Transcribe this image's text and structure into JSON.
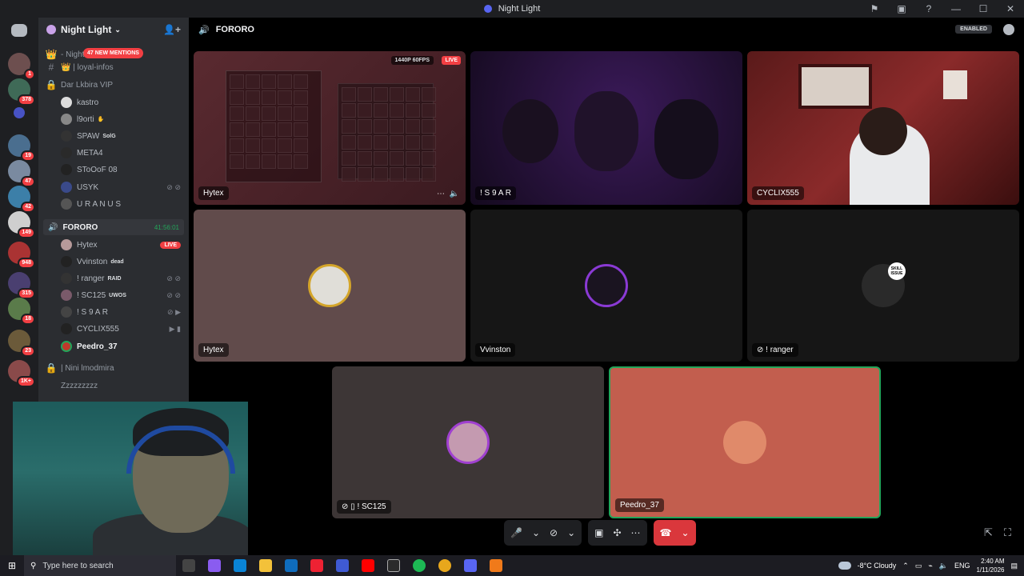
{
  "window": {
    "title": "Night Light",
    "controls": {
      "minimize": "—",
      "maximize": "☐",
      "close": "✕"
    }
  },
  "guild_badges": [
    "1",
    "378",
    "19",
    "47",
    "42",
    "149",
    "948",
    "315",
    "18",
    "23",
    "1K+"
  ],
  "server": {
    "name": "Night Light",
    "mentions": "47 NEW MENTIONS",
    "channels": [
      {
        "icon": "👑",
        "name": "- Night"
      },
      {
        "icon": "#",
        "name": "👑 | loyal-infos"
      },
      {
        "icon": "🔒",
        "name": "Dar Lkbira VIP"
      }
    ],
    "vip_users": [
      {
        "name": "kastro",
        "tag": ""
      },
      {
        "name": "l9orti",
        "tag": "✋"
      },
      {
        "name": "SPAW",
        "tag": "SolG"
      },
      {
        "name": "META4",
        "tag": ""
      },
      {
        "name": "SToOoF 08",
        "tag": ""
      },
      {
        "name": "USYK",
        "tag": ""
      },
      {
        "name": "U R A N U S",
        "tag": ""
      }
    ],
    "voice_channel": {
      "name": "FORORO",
      "timer": "41:56:01"
    },
    "voice_users": [
      {
        "name": "Hytex",
        "tag": "LIVE"
      },
      {
        "name": "Vvinston",
        "tag": "dead"
      },
      {
        "name": "! ranger",
        "tag": "RAID"
      },
      {
        "name": "! SC125",
        "tag": "UWOS"
      },
      {
        "name": "! S 9 A R",
        "tag": ""
      },
      {
        "name": "CYCLIX555",
        "tag": ""
      },
      {
        "name": "Peedro_37",
        "tag": ""
      }
    ],
    "more_channels": [
      {
        "icon": "🔒",
        "name": "| Nini lmodmira"
      },
      {
        "icon": "",
        "name": "Zzzzzzzzz"
      }
    ]
  },
  "call": {
    "channel": "FORORO",
    "enabled": "ENABLED",
    "stream_quality": "1440P 60FPS",
    "live": "LIVE",
    "tiles": [
      {
        "name": "Hytex",
        "type": "stream"
      },
      {
        "name": "! S 9 A R",
        "type": "video"
      },
      {
        "name": "CYCLIX555",
        "type": "video"
      },
      {
        "name": "Hytex",
        "type": "avatar"
      },
      {
        "name": "Vvinston",
        "type": "avatar"
      },
      {
        "name": "! ranger",
        "type": "avatar"
      },
      {
        "name": "! SC125",
        "type": "avatar"
      },
      {
        "name": "Peedro_37",
        "type": "avatar"
      }
    ],
    "skill_issue": "SKILL ISSUE"
  },
  "taskbar": {
    "search_placeholder": "Type here to search",
    "weather": "-8°C  Cloudy",
    "lang": "ENG",
    "time": "2:40 AM",
    "date": "1/11/2026"
  },
  "colors": {
    "discord_dark": "#1e1f22",
    "sidebar": "#2b2d31",
    "live_red": "#f23f43",
    "hangup_red": "#da373c",
    "speaking_green": "#23a55a"
  }
}
